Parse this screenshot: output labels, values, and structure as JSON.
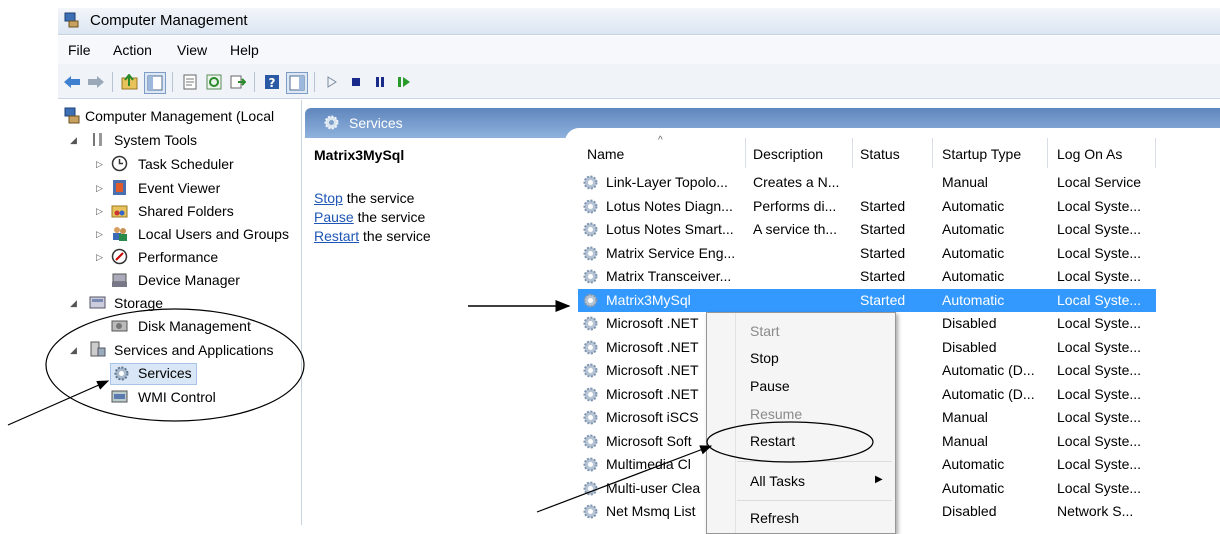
{
  "window": {
    "title": "Computer Management"
  },
  "menu": [
    "File",
    "Action",
    "View",
    "Help"
  ],
  "toolbar": {
    "icons": [
      "back-icon",
      "forward-icon",
      "up-folder-icon",
      "show-hide-tree-icon",
      "properties-icon",
      "refresh-icon",
      "export-list-icon",
      "help-icon",
      "show-action-pane-icon",
      "start-icon",
      "stop-icon",
      "pause-icon",
      "resume-icon"
    ]
  },
  "tree": {
    "root": "Computer Management (Local",
    "system_tools": "System Tools",
    "task_scheduler": "Task Scheduler",
    "event_viewer": "Event Viewer",
    "shared_folders": "Shared Folders",
    "local_users": "Local Users and Groups",
    "performance": "Performance",
    "device_manager": "Device Manager",
    "storage": "Storage",
    "disk_management": "Disk Management",
    "services_apps": "Services and Applications",
    "services": "Services",
    "wmi": "WMI Control"
  },
  "pane": {
    "title": "Services",
    "selected_service": "Matrix3MySql",
    "stop_link": "Stop",
    "stop_rest": " the service",
    "pause_link": "Pause",
    "pause_rest": " the service",
    "restart_link": "Restart",
    "restart_rest": " the service"
  },
  "table": {
    "columns": [
      "Name",
      "Description",
      "Status",
      "Startup Type",
      "Log On As"
    ],
    "rows": [
      [
        "Link-Layer Topolo...",
        "Creates a N...",
        "",
        "Manual",
        "Local Service"
      ],
      [
        "Lotus Notes Diagn...",
        "Performs di...",
        "Started",
        "Automatic",
        "Local Syste..."
      ],
      [
        "Lotus Notes Smart...",
        "A service th...",
        "Started",
        "Automatic",
        "Local Syste..."
      ],
      [
        "Matrix Service Eng...",
        "",
        "Started",
        "Automatic",
        "Local Syste..."
      ],
      [
        "Matrix Transceiver...",
        "",
        "Started",
        "Automatic",
        "Local Syste..."
      ],
      [
        "Matrix3MySql",
        "",
        "Started",
        "Automatic",
        "Local Syste..."
      ],
      [
        "Microsoft .NET",
        "",
        "",
        "Disabled",
        "Local Syste..."
      ],
      [
        "Microsoft .NET",
        "",
        "",
        "Disabled",
        "Local Syste..."
      ],
      [
        "Microsoft .NET",
        "",
        "",
        "Automatic (D...",
        "Local Syste..."
      ],
      [
        "Microsoft .NET",
        "",
        "",
        "Automatic (D...",
        "Local Syste..."
      ],
      [
        "Microsoft iSCS",
        "",
        "",
        "Manual",
        "Local Syste..."
      ],
      [
        "Microsoft Soft",
        "",
        "",
        "Manual",
        "Local Syste..."
      ],
      [
        "Multimedia Cl",
        "",
        "ed",
        "Automatic",
        "Local Syste..."
      ],
      [
        "Multi-user Clea",
        "",
        "ed",
        "Automatic",
        "Local Syste..."
      ],
      [
        "Net Msmq List",
        "",
        "",
        "Disabled",
        "Network S..."
      ]
    ]
  },
  "context_menu": {
    "start": "Start",
    "stop": "Stop",
    "pause": "Pause",
    "resume": "Resume",
    "restart": "Restart",
    "all_tasks": "All Tasks",
    "refresh": "Refresh"
  },
  "colors": {
    "selection": "#3399ff",
    "header": "#5f86bd",
    "link": "#1e56b5"
  }
}
